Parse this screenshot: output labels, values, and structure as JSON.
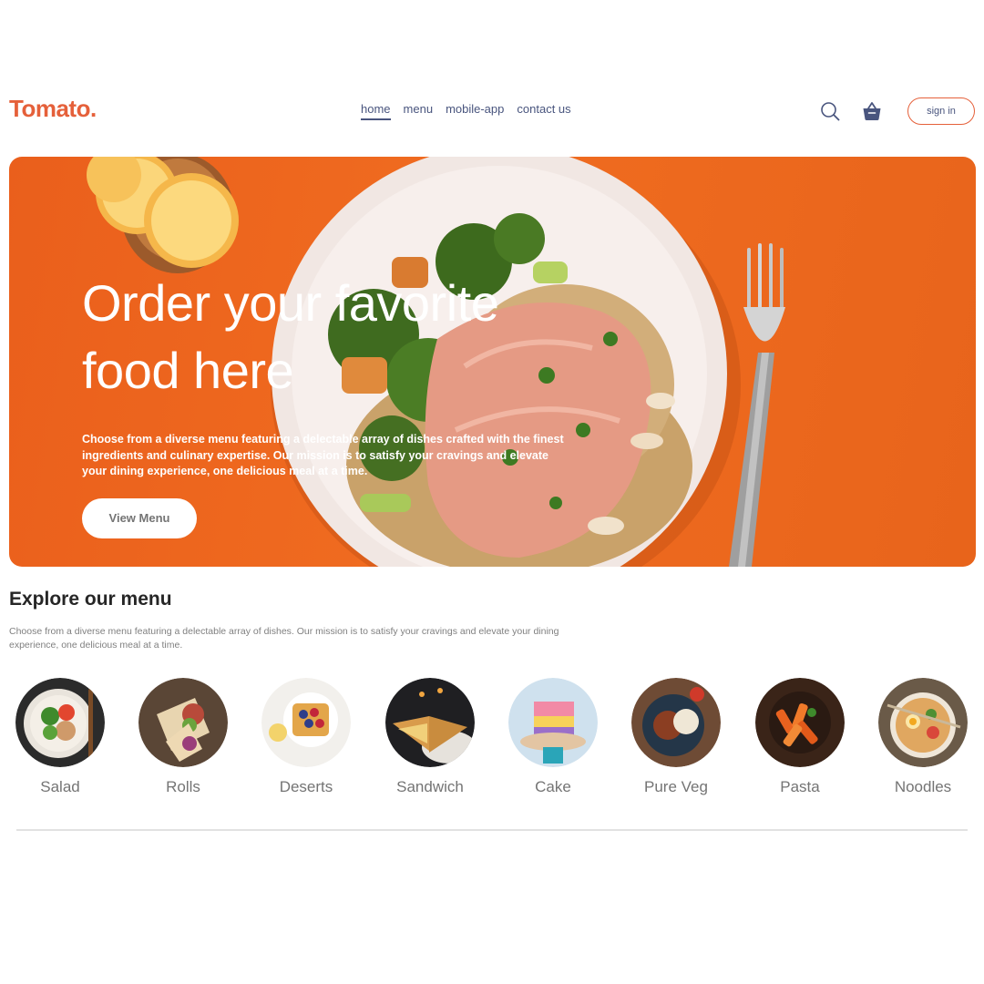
{
  "brand": {
    "logo": "Tomato.",
    "accent": "#e5603a",
    "nav_color": "#49557e"
  },
  "nav": {
    "links": [
      {
        "label": "home",
        "active": true
      },
      {
        "label": "menu",
        "active": false
      },
      {
        "label": "mobile-app",
        "active": false
      },
      {
        "label": "contact us",
        "active": false
      }
    ],
    "search_icon": "search-icon",
    "basket_icon": "basket-icon",
    "signin_label": "sign in"
  },
  "hero": {
    "title_line1": "Order your favorite",
    "title_line2": "food here",
    "description": "Choose from a diverse menu featuring a delectable array of dishes crafted with the finest ingredients and culinary expertise. Our mission is to satisfy your cravings and elevate your dining experience, one delicious meal at a time.",
    "button_label": "View Menu",
    "background": "#ec671f"
  },
  "explore": {
    "title": "Explore our menu",
    "description": "Choose from a diverse menu featuring a delectable array of dishes. Our mission is to satisfy your cravings and elevate your dining experience, one delicious meal at a time.",
    "items": [
      {
        "label": "Salad"
      },
      {
        "label": "Rolls"
      },
      {
        "label": "Deserts"
      },
      {
        "label": "Sandwich"
      },
      {
        "label": "Cake"
      },
      {
        "label": "Pure Veg"
      },
      {
        "label": "Pasta"
      },
      {
        "label": "Noodles"
      }
    ]
  }
}
